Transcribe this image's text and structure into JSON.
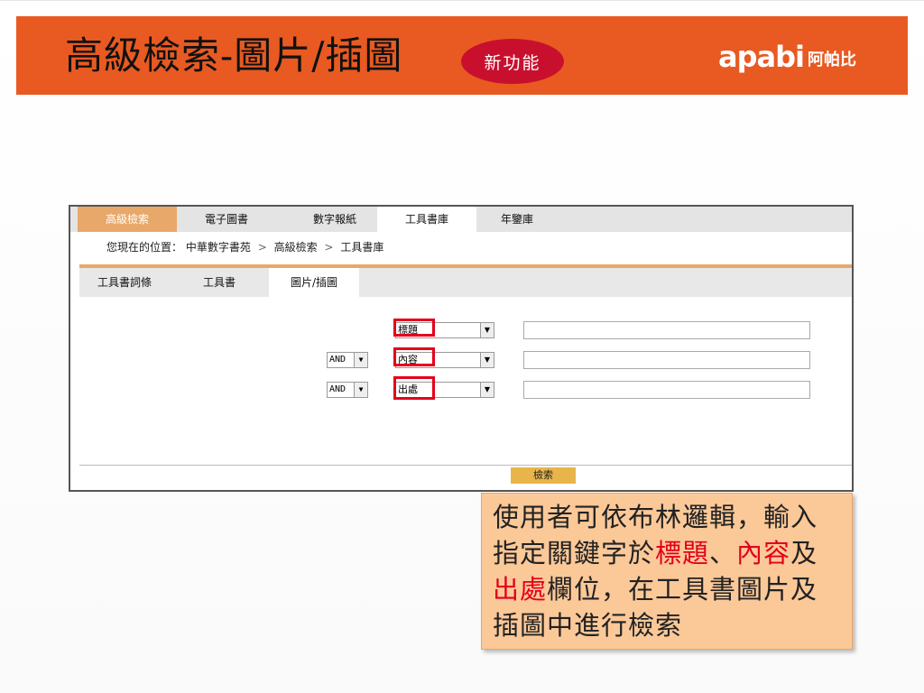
{
  "header": {
    "title": "高級檢索-圖片/插圖",
    "badge": "新功能",
    "logo_latin": "apabi",
    "logo_cjk": "阿帕比"
  },
  "top_nav": {
    "items": [
      "高級檢索",
      "電子圖書",
      "數字報紙",
      "工具書庫",
      "年鑒庫"
    ],
    "active_index": 0,
    "current_index": 3
  },
  "breadcrumb": {
    "prefix": "您現在的位置：",
    "items": [
      "中華數字書苑",
      "高級檢索",
      "工具書庫"
    ],
    "separator": ">"
  },
  "sub_tabs": {
    "items": [
      "工具書詞條",
      "工具書",
      "圖片/插圖"
    ],
    "current_index": 2
  },
  "search_rows": [
    {
      "operator": "",
      "field": "標題",
      "value": ""
    },
    {
      "operator": "AND",
      "field": "內容",
      "value": ""
    },
    {
      "operator": "AND",
      "field": "出處",
      "value": ""
    }
  ],
  "search_button": "檢索",
  "callout": {
    "part1": "使用者可依布林邏輯，輸入指定關鍵字於",
    "hl1": "標題",
    "part2": "、",
    "hl2": "內容",
    "part3": "及",
    "hl3": "出處",
    "part4": "欄位，在工具書圖片及插圖中進行檢索"
  },
  "colors": {
    "banner": "#e85a21",
    "badge": "#c8102e",
    "nav_active": "#e8a86a",
    "highlight": "#e3001b",
    "callout_bg": "#fbc898",
    "search_button": "#e8b54a"
  },
  "icons": {
    "dropdown": "chevron-down-icon"
  }
}
